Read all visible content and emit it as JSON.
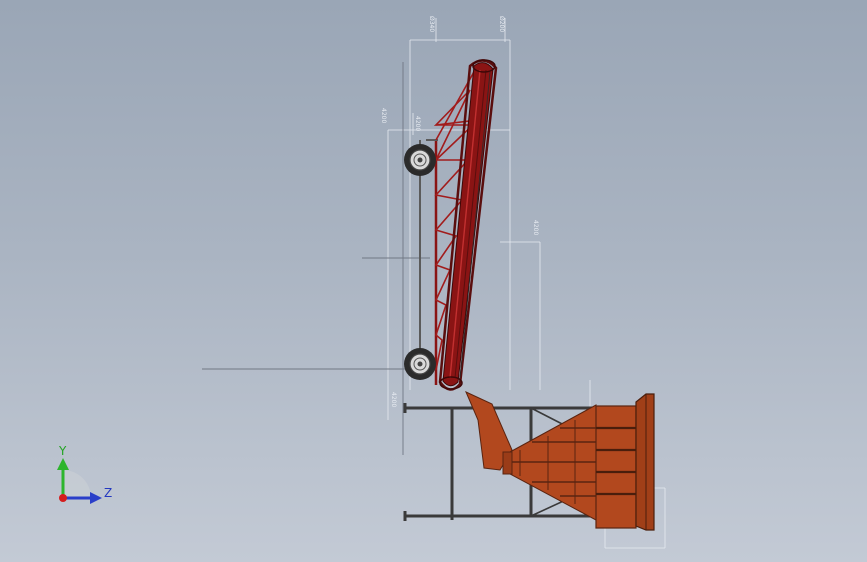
{
  "dimension_labels": {
    "d1": "Ø340",
    "d2": "Ø200",
    "d3": "4200",
    "d4": "4200",
    "d5": "4200",
    "d6": "4200",
    "d7": "1440",
    "d8": "1100",
    "d9": "1800"
  },
  "triad": {
    "y_label": "Y",
    "z_label": "Z"
  },
  "colors": {
    "background_top": "#9aa6b6",
    "background_bottom": "#c3cad5",
    "belt": "#8a1414",
    "hopper": "#b2481e",
    "dimension_line": "#e6eaf0",
    "axis_y": "#2db52d",
    "axis_z": "#2a3fc9",
    "axis_x": "#d41d1d"
  }
}
